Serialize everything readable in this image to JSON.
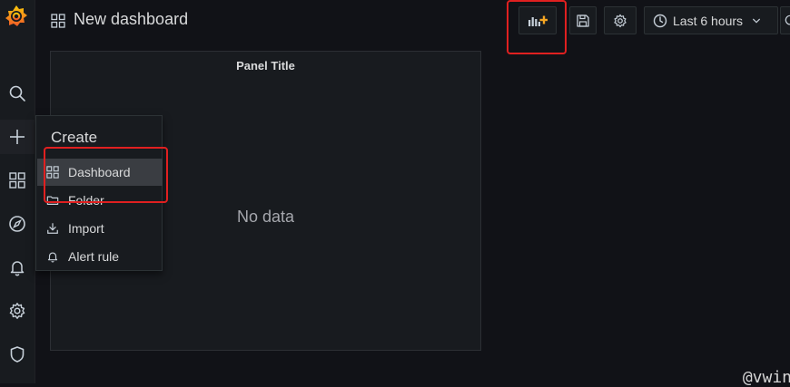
{
  "header": {
    "title": "New dashboard",
    "time_range_label": "Last 6 hours"
  },
  "sidebar": {
    "items": [
      {
        "name": "search",
        "icon": "search-icon"
      },
      {
        "name": "create",
        "icon": "plus-icon"
      },
      {
        "name": "dashboards",
        "icon": "apps-icon"
      },
      {
        "name": "explore",
        "icon": "compass-icon"
      },
      {
        "name": "alerting",
        "icon": "bell-icon"
      },
      {
        "name": "configuration",
        "icon": "gear-icon"
      },
      {
        "name": "server-admin",
        "icon": "shield-icon"
      }
    ]
  },
  "create_menu": {
    "heading": "Create",
    "items": [
      {
        "label": "Dashboard",
        "icon": "apps-icon",
        "active": true
      },
      {
        "label": "Folder",
        "icon": "folder-icon"
      },
      {
        "label": "Import",
        "icon": "import-icon"
      },
      {
        "label": "Alert rule",
        "icon": "bell-icon"
      }
    ]
  },
  "panel": {
    "title": "Panel Title",
    "empty_text": "No data"
  },
  "watermark": "@vwin",
  "colors": {
    "background": "#111217",
    "sidebar": "#181b1f",
    "accent_orange": "#f5a623",
    "highlight_red": "#e02020"
  }
}
